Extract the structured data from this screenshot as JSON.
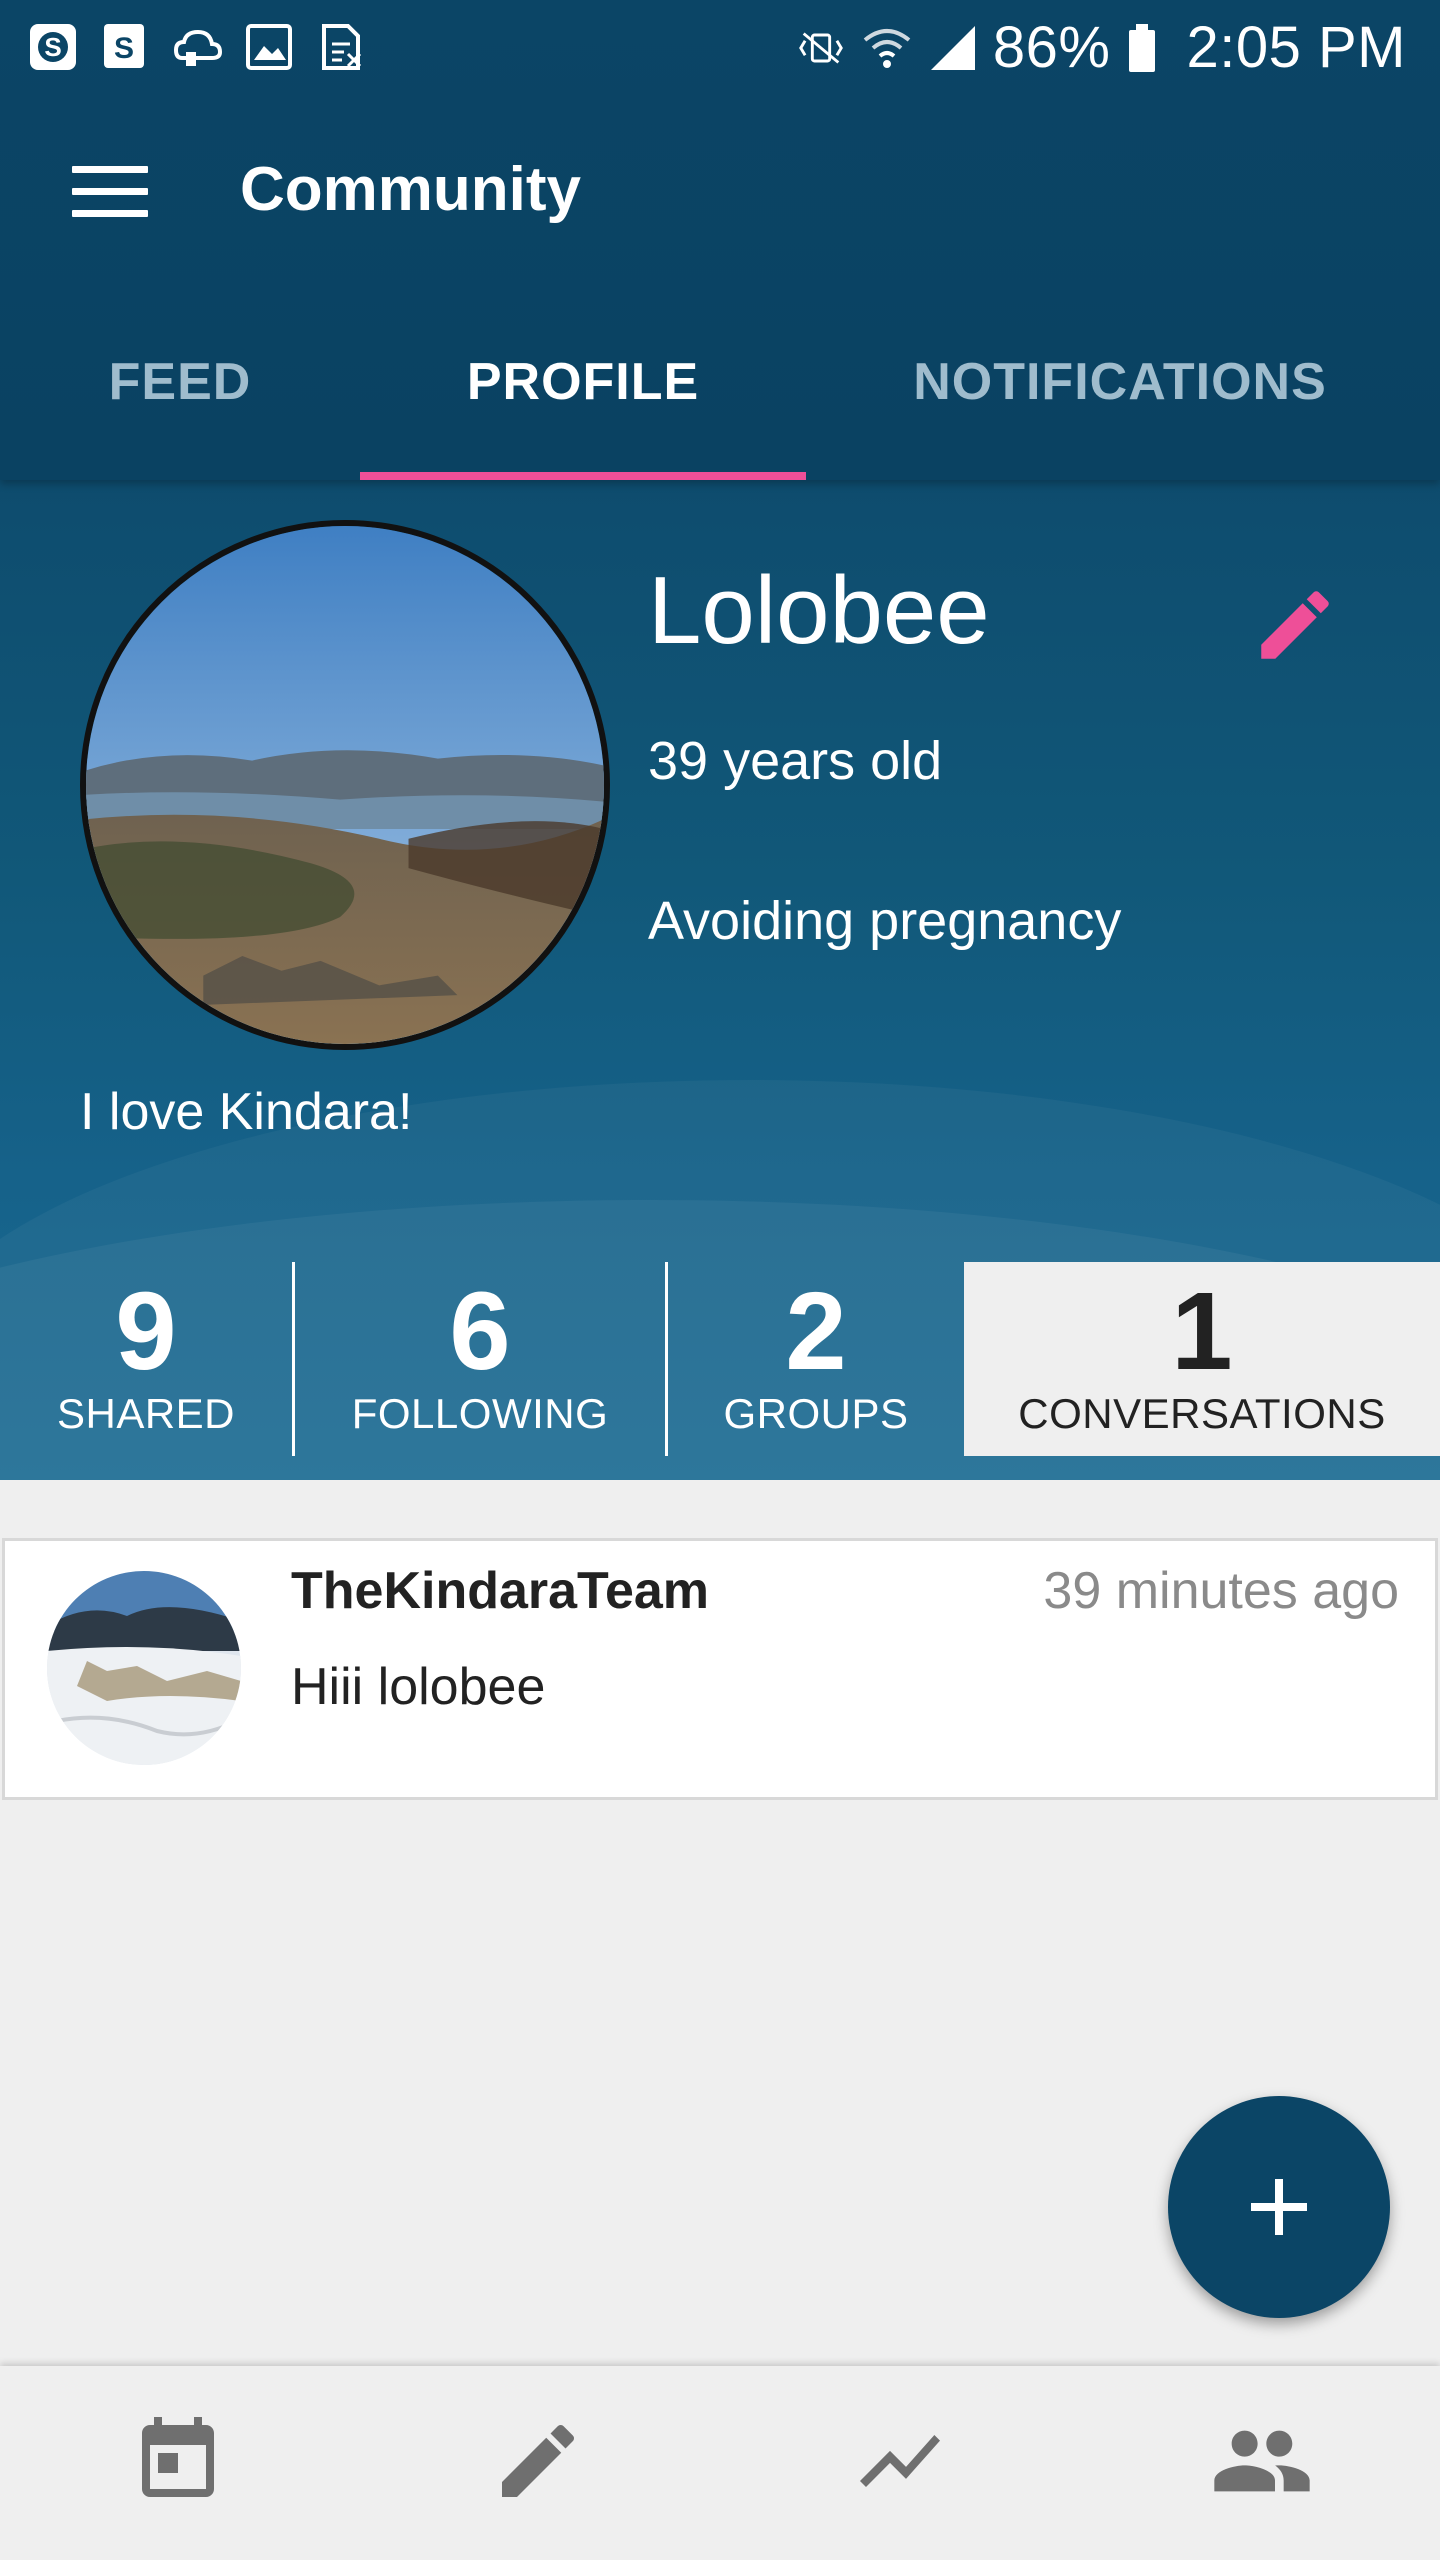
{
  "status_bar": {
    "battery": "86%",
    "time": "2:05 PM",
    "left_icons": [
      "skype-icon",
      "skype-business-icon",
      "cloud-icon",
      "image-icon",
      "sim-icon"
    ],
    "right_icons": [
      "vibrate-mute-icon",
      "wifi-icon",
      "signal-icon",
      "battery-icon"
    ]
  },
  "app_bar": {
    "title": "Community",
    "menu_icon": "hamburger-menu-icon"
  },
  "tabs": [
    {
      "label": "FEED",
      "active": false
    },
    {
      "label": "PROFILE",
      "active": true
    },
    {
      "label": "NOTIFICATIONS",
      "active": false
    }
  ],
  "profile": {
    "username": "Lolobee",
    "age": "39 years old",
    "goal": "Avoiding pregnancy",
    "bio": "I love Kindara!"
  },
  "stats": [
    {
      "value": "9",
      "label": "SHARED",
      "active": false
    },
    {
      "value": "6",
      "label": "FOLLOWING",
      "active": false
    },
    {
      "value": "2",
      "label": "GROUPS",
      "active": false
    },
    {
      "value": "1",
      "label": "CONVERSATIONS",
      "active": true
    }
  ],
  "conversations": [
    {
      "name": "TheKindaraTeam",
      "time": "39 minutes ago",
      "message": "Hiii lolobee"
    }
  ],
  "fab": {
    "icon": "plus-icon"
  },
  "bottom_nav": [
    {
      "icon": "calendar-icon"
    },
    {
      "icon": "pencil-icon"
    },
    {
      "icon": "chart-line-icon"
    },
    {
      "icon": "people-icon"
    }
  ],
  "colors": {
    "header": "#0b4566",
    "accent": "#ee4f98",
    "background": "#efefef"
  }
}
